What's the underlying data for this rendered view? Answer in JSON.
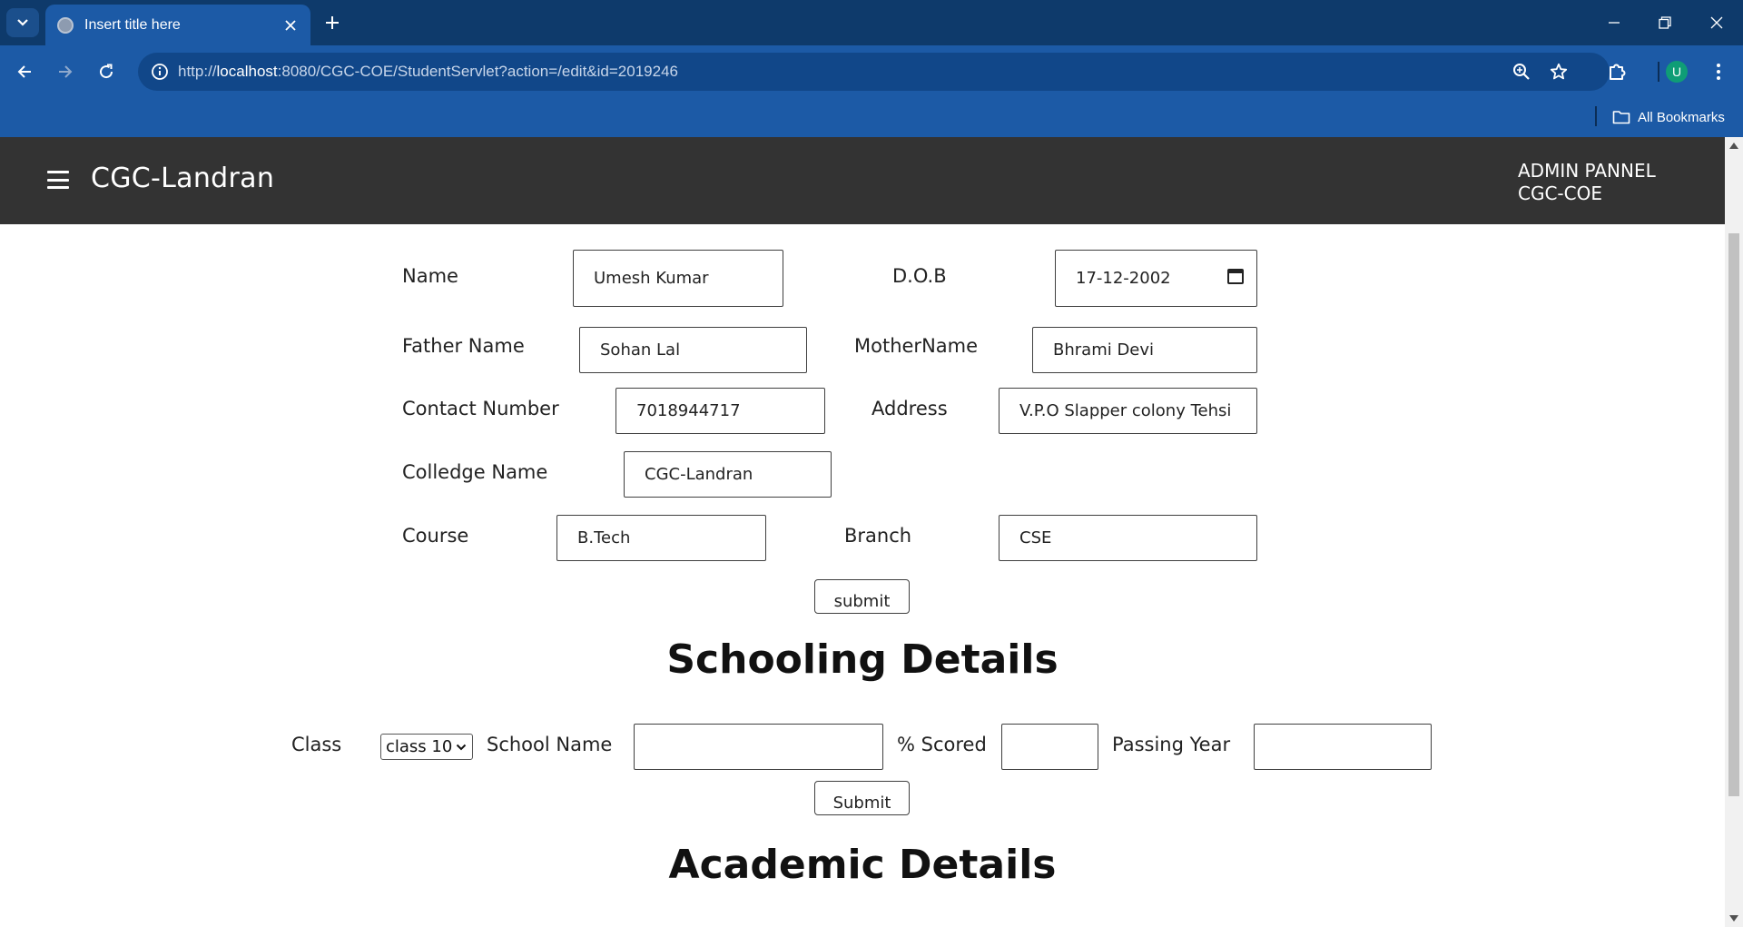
{
  "browser": {
    "tab_title": "Insert title here",
    "url_prefix": "http://",
    "url_host": "localhost",
    "url_rest": ":8080/CGC-COE/StudentServlet?action=/edit&id=2019246",
    "profile_initial": "U",
    "bookmarks_label": "All Bookmarks"
  },
  "header": {
    "brand": "CGC-Landran",
    "admin_line1": "ADMIN PANNEL",
    "admin_line2": "CGC-COE"
  },
  "student_form": {
    "name_label": "Name",
    "name_value": "Umesh Kumar",
    "dob_label": "D.O.B",
    "dob_value": "17-12-2002",
    "father_label": "Father Name",
    "father_value": "Sohan Lal",
    "mother_label": "MotherName",
    "mother_value": "Bhrami Devi",
    "contact_label": "Contact Number",
    "contact_value": "7018944717",
    "address_label": "Address",
    "address_value": "V.P.O Slapper colony Tehsi",
    "college_label": "Colledge Name",
    "college_value": "CGC-Landran",
    "course_label": "Course",
    "course_value": "B.Tech",
    "branch_label": "Branch",
    "branch_value": "CSE",
    "submit_label": "submit"
  },
  "schooling": {
    "heading": "Schooling Details",
    "class_label": "Class",
    "class_selected": "class 10",
    "school_label": "School Name",
    "school_value": "",
    "scored_label": "% Scored",
    "scored_value": "",
    "year_label": "Passing Year",
    "year_value": "",
    "submit_label": "Submit"
  },
  "academic": {
    "heading": "Academic Details"
  }
}
